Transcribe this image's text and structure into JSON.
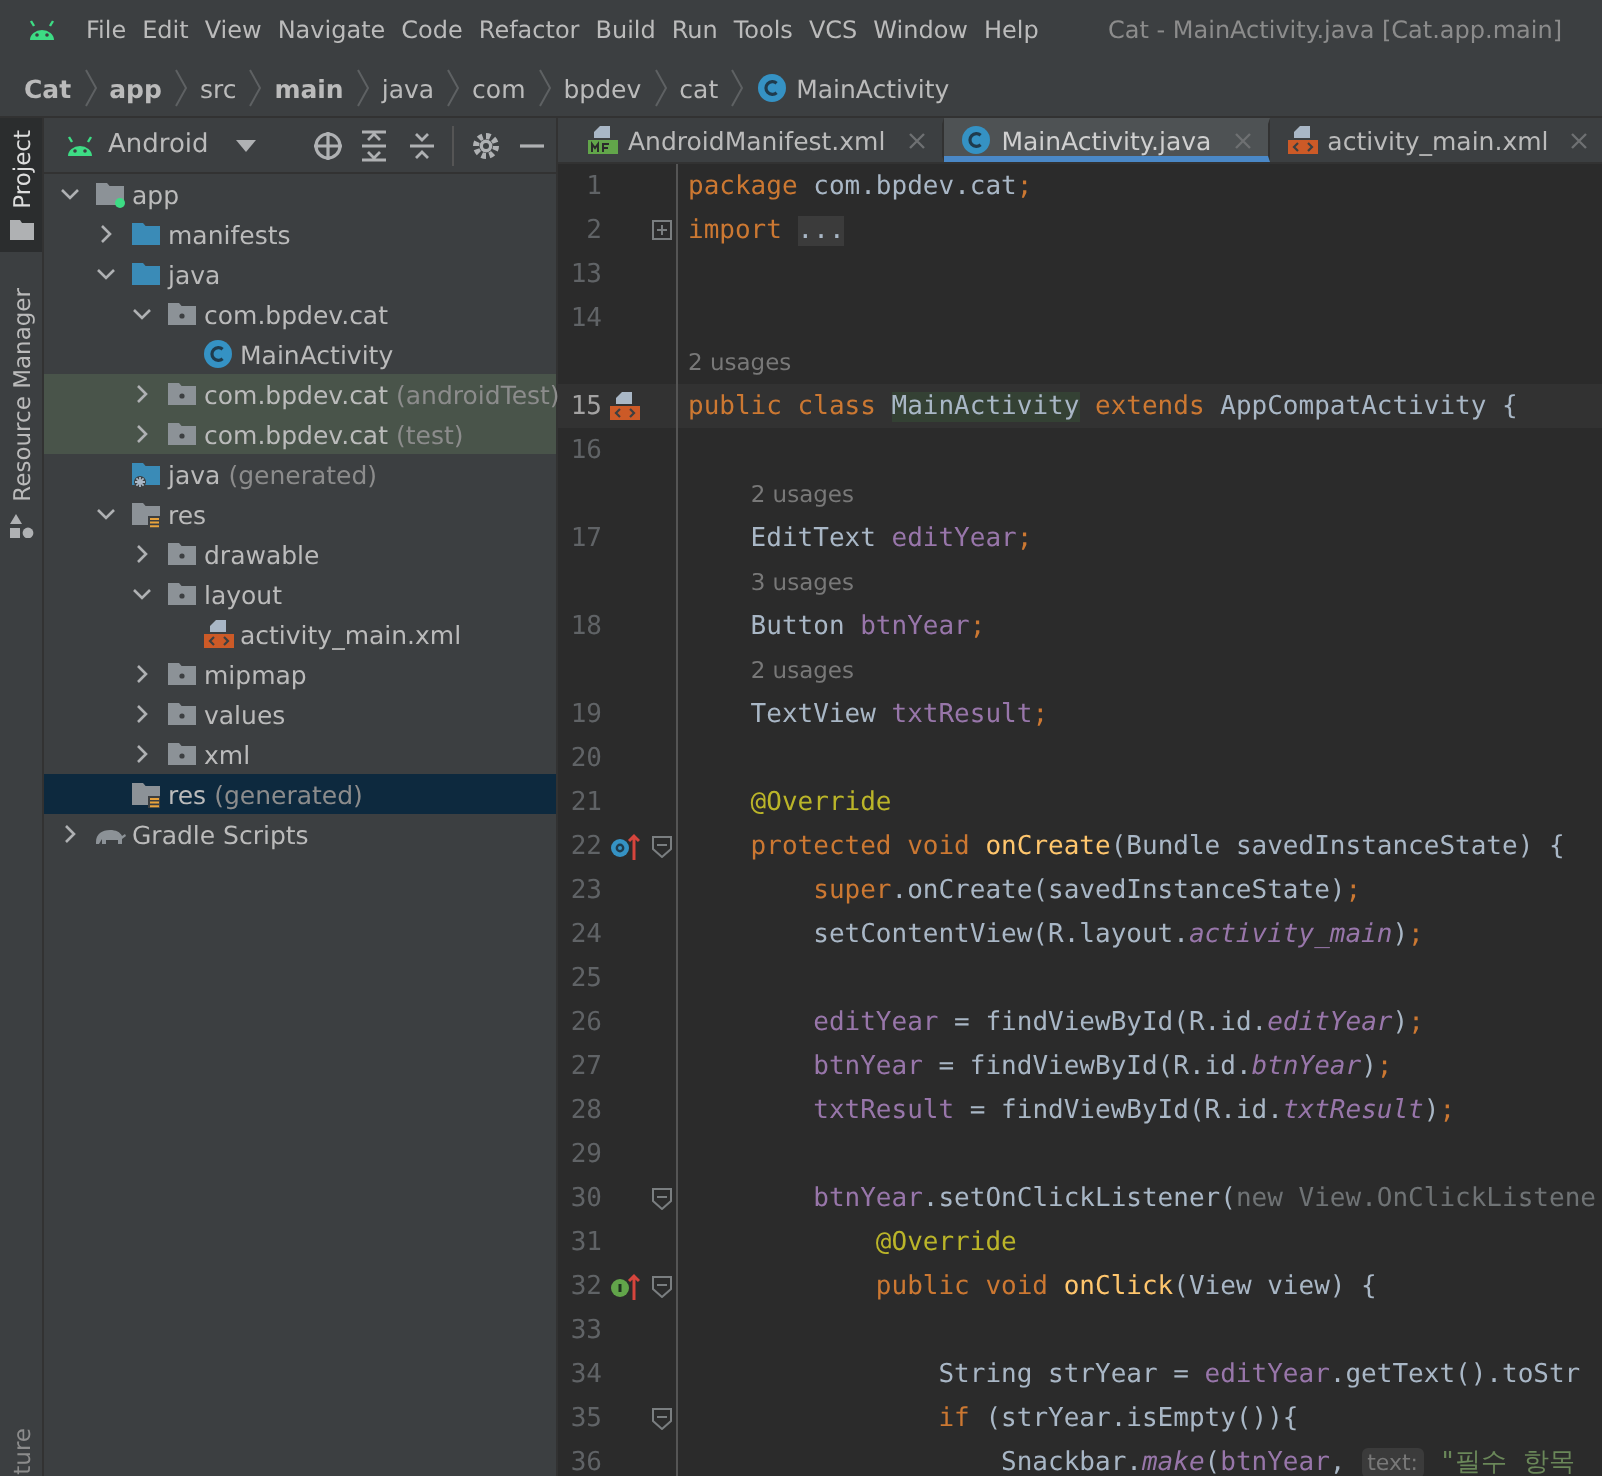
{
  "menu_bar": {
    "items": [
      "File",
      "Edit",
      "View",
      "Navigate",
      "Code",
      "Refactor",
      "Build",
      "Run",
      "Tools",
      "VCS",
      "Window",
      "Help"
    ],
    "title": "Cat - MainActivity.java [Cat.app.main]"
  },
  "breadcrumb": [
    {
      "text": "Cat",
      "bold": true,
      "kind": "plain"
    },
    {
      "text": "app",
      "bold": true,
      "kind": "plain"
    },
    {
      "text": "src",
      "bold": false,
      "kind": "plain"
    },
    {
      "text": "main",
      "bold": true,
      "kind": "plain"
    },
    {
      "text": "java",
      "bold": false,
      "kind": "plain"
    },
    {
      "text": "com",
      "bold": false,
      "kind": "plain"
    },
    {
      "text": "bpdev",
      "bold": false,
      "kind": "plain"
    },
    {
      "text": "cat",
      "bold": false,
      "kind": "plain"
    },
    {
      "text": "MainActivity",
      "bold": false,
      "kind": "class"
    }
  ],
  "tool_strip": {
    "tabs": [
      {
        "label": "Project",
        "selected": true
      },
      {
        "label": "Resource Manager",
        "selected": false
      }
    ],
    "bottom_tabs": [
      {
        "label": "ture",
        "selected": false
      }
    ]
  },
  "project_panel": {
    "view": "Android",
    "tree": [
      {
        "text": "app",
        "kind": "module",
        "expanded": true,
        "selected": false,
        "children": [
          {
            "text": "manifests",
            "kind": "source-folder",
            "expanded": false,
            "selected": false
          },
          {
            "text": "java",
            "kind": "source-folder",
            "expanded": true,
            "selected": false,
            "children": [
              {
                "text": "com.bpdev.cat",
                "kind": "package",
                "expanded": true,
                "selected": false,
                "test_scope": false,
                "children": [
                  {
                    "text": "MainActivity",
                    "kind": "class",
                    "selected": false
                  }
                ]
              },
              {
                "text": "com.bpdev.cat",
                "suffix": "(androidTest)",
                "kind": "package",
                "expanded": false,
                "selected": false,
                "test_scope": true
              },
              {
                "text": "com.bpdev.cat",
                "suffix": "(test)",
                "kind": "package",
                "expanded": false,
                "selected": false,
                "test_scope": true
              }
            ]
          },
          {
            "text": "java",
            "suffix": "(generated)",
            "kind": "generated-folder",
            "selected": false
          },
          {
            "text": "res",
            "kind": "res-folder",
            "expanded": true,
            "selected": false,
            "children": [
              {
                "text": "drawable",
                "kind": "package",
                "expanded": false,
                "selected": false
              },
              {
                "text": "layout",
                "kind": "package",
                "expanded": true,
                "selected": false,
                "children": [
                  {
                    "text": "activity_main.xml",
                    "kind": "layout-file",
                    "selected": false
                  }
                ]
              },
              {
                "text": "mipmap",
                "kind": "package",
                "expanded": false,
                "selected": false
              },
              {
                "text": "values",
                "kind": "package",
                "expanded": false,
                "selected": false
              },
              {
                "text": "xml",
                "kind": "package",
                "expanded": false,
                "selected": false
              }
            ]
          },
          {
            "text": "res",
            "suffix": "(generated)",
            "kind": "res-folder",
            "selected": true
          }
        ]
      },
      {
        "text": "Gradle Scripts",
        "kind": "gradle",
        "expanded": false,
        "selected": false
      }
    ]
  },
  "editor": {
    "tabs": [
      {
        "label": "AndroidManifest.xml",
        "kind": "manifest",
        "selected": false
      },
      {
        "label": "MainActivity.java",
        "kind": "class",
        "selected": true
      },
      {
        "label": "activity_main.xml",
        "kind": "layout",
        "selected": false
      }
    ],
    "lines": [
      {
        "kind": "code",
        "number": "1",
        "current": false,
        "code": [
          {
            "kind": "keyword",
            "text": "package"
          },
          {
            "kind": "plain",
            "text": " com.bpdev.cat"
          },
          {
            "kind": "keyword",
            "text": ";"
          }
        ]
      },
      {
        "kind": "code",
        "number": "2",
        "current": false,
        "folded": true,
        "code": [
          {
            "kind": "keyword",
            "text": "import "
          },
          {
            "kind": "folded",
            "text": "..."
          }
        ]
      },
      {
        "kind": "code",
        "number": "13",
        "current": false
      },
      {
        "kind": "code",
        "number": "14",
        "current": false
      },
      {
        "kind": "hint",
        "text": "2 usages"
      },
      {
        "kind": "code",
        "number": "15",
        "current": true,
        "gutter": {
          "kind": "layout"
        },
        "code": [
          {
            "kind": "keyword",
            "text": "public class "
          },
          {
            "kind": "highlight",
            "text": "MainActivity"
          },
          {
            "kind": "keyword",
            "text": " extends "
          },
          {
            "kind": "plain",
            "text": "AppCompatActivity {"
          }
        ]
      },
      {
        "kind": "code",
        "number": "16",
        "current": false
      },
      {
        "kind": "hint",
        "text": "    2 usages"
      },
      {
        "kind": "code",
        "number": "17",
        "current": false,
        "code": [
          {
            "kind": "plain",
            "text": "    EditText "
          },
          {
            "kind": "field",
            "text": "editYear"
          },
          {
            "kind": "keyword",
            "text": ";"
          }
        ]
      },
      {
        "kind": "hint",
        "text": "    3 usages"
      },
      {
        "kind": "code",
        "number": "18",
        "current": false,
        "code": [
          {
            "kind": "plain",
            "text": "    Button "
          },
          {
            "kind": "field",
            "text": "btnYear"
          },
          {
            "kind": "keyword",
            "text": ";"
          }
        ]
      },
      {
        "kind": "hint",
        "text": "    2 usages"
      },
      {
        "kind": "code",
        "number": "19",
        "current": false,
        "code": [
          {
            "kind": "plain",
            "text": "    TextView "
          },
          {
            "kind": "field",
            "text": "txtResult"
          },
          {
            "kind": "keyword",
            "text": ";"
          }
        ]
      },
      {
        "kind": "code",
        "number": "20",
        "current": false
      },
      {
        "kind": "code",
        "number": "21",
        "current": false,
        "code": [
          {
            "kind": "annotation",
            "text": "    @Override"
          }
        ]
      },
      {
        "kind": "code",
        "number": "22",
        "current": false,
        "gutter": {
          "kind": "override"
        },
        "folded": false,
        "code": [
          {
            "kind": "keyword",
            "text": "    protected void "
          },
          {
            "kind": "method",
            "text": "onCreate"
          },
          {
            "kind": "plain",
            "text": "(Bundle savedInstanceState) {"
          }
        ]
      },
      {
        "kind": "code",
        "number": "23",
        "current": false,
        "code": [
          {
            "kind": "keyword",
            "text": "        super"
          },
          {
            "kind": "plain",
            "text": ".onCreate(savedInstanceState)"
          },
          {
            "kind": "keyword",
            "text": ";"
          }
        ]
      },
      {
        "kind": "code",
        "number": "24",
        "current": false,
        "code": [
          {
            "kind": "plain",
            "text": "        setContentView(R.layout."
          },
          {
            "kind": "static",
            "text": "activity_main"
          },
          {
            "kind": "plain",
            "text": ")"
          },
          {
            "kind": "keyword",
            "text": ";"
          }
        ]
      },
      {
        "kind": "code",
        "number": "25",
        "current": false
      },
      {
        "kind": "code",
        "number": "26",
        "current": false,
        "code": [
          {
            "kind": "field",
            "text": "        editYear"
          },
          {
            "kind": "plain",
            "text": " = findViewById(R.id."
          },
          {
            "kind": "static",
            "text": "editYear"
          },
          {
            "kind": "plain",
            "text": ")"
          },
          {
            "kind": "keyword",
            "text": ";"
          }
        ]
      },
      {
        "kind": "code",
        "number": "27",
        "current": false,
        "code": [
          {
            "kind": "field",
            "text": "        btnYear"
          },
          {
            "kind": "plain",
            "text": " = findViewById(R.id."
          },
          {
            "kind": "static",
            "text": "btnYear"
          },
          {
            "kind": "plain",
            "text": ")"
          },
          {
            "kind": "keyword",
            "text": ";"
          }
        ]
      },
      {
        "kind": "code",
        "number": "28",
        "current": false,
        "code": [
          {
            "kind": "field",
            "text": "        txtResult"
          },
          {
            "kind": "plain",
            "text": " = findViewById(R.id."
          },
          {
            "kind": "static",
            "text": "txtResult"
          },
          {
            "kind": "plain",
            "text": ")"
          },
          {
            "kind": "keyword",
            "text": ";"
          }
        ]
      },
      {
        "kind": "code",
        "number": "29",
        "current": false
      },
      {
        "kind": "code",
        "number": "30",
        "current": false,
        "folded": false,
        "code": [
          {
            "kind": "field",
            "text": "        btnYear"
          },
          {
            "kind": "plain",
            "text": ".setOnClickListener("
          },
          {
            "kind": "dim",
            "text": "new View.OnClickListene"
          }
        ]
      },
      {
        "kind": "code",
        "number": "31",
        "current": false,
        "code": [
          {
            "kind": "annotation",
            "text": "            @Override"
          }
        ]
      },
      {
        "kind": "code",
        "number": "32",
        "current": false,
        "gutter": {
          "kind": "implements"
        },
        "folded": false,
        "code": [
          {
            "kind": "keyword",
            "text": "            public void "
          },
          {
            "kind": "method",
            "text": "onClick"
          },
          {
            "kind": "plain",
            "text": "(View view) {"
          }
        ]
      },
      {
        "kind": "code",
        "number": "33",
        "current": false
      },
      {
        "kind": "code",
        "number": "34",
        "current": false,
        "code": [
          {
            "kind": "plain",
            "text": "                String strYear = "
          },
          {
            "kind": "field",
            "text": "editYear"
          },
          {
            "kind": "plain",
            "text": ".getText().toStr"
          }
        ]
      },
      {
        "kind": "code",
        "number": "35",
        "current": false,
        "folded": false,
        "code": [
          {
            "kind": "keyword",
            "text": "                if "
          },
          {
            "kind": "plain",
            "text": "(strYear.isEmpty()){"
          }
        ]
      },
      {
        "kind": "code",
        "number": "36",
        "current": false,
        "code": [
          {
            "kind": "plain",
            "text": "                    Snackbar."
          },
          {
            "kind": "static",
            "text": "make"
          },
          {
            "kind": "plain",
            "text": "("
          },
          {
            "kind": "field",
            "text": "btnYear"
          },
          {
            "kind": "plain",
            "text": ", "
          },
          {
            "kind": "inlay",
            "text": "text:"
          },
          {
            "kind": "string",
            "text": " \"필수 항목"
          }
        ]
      }
    ]
  }
}
